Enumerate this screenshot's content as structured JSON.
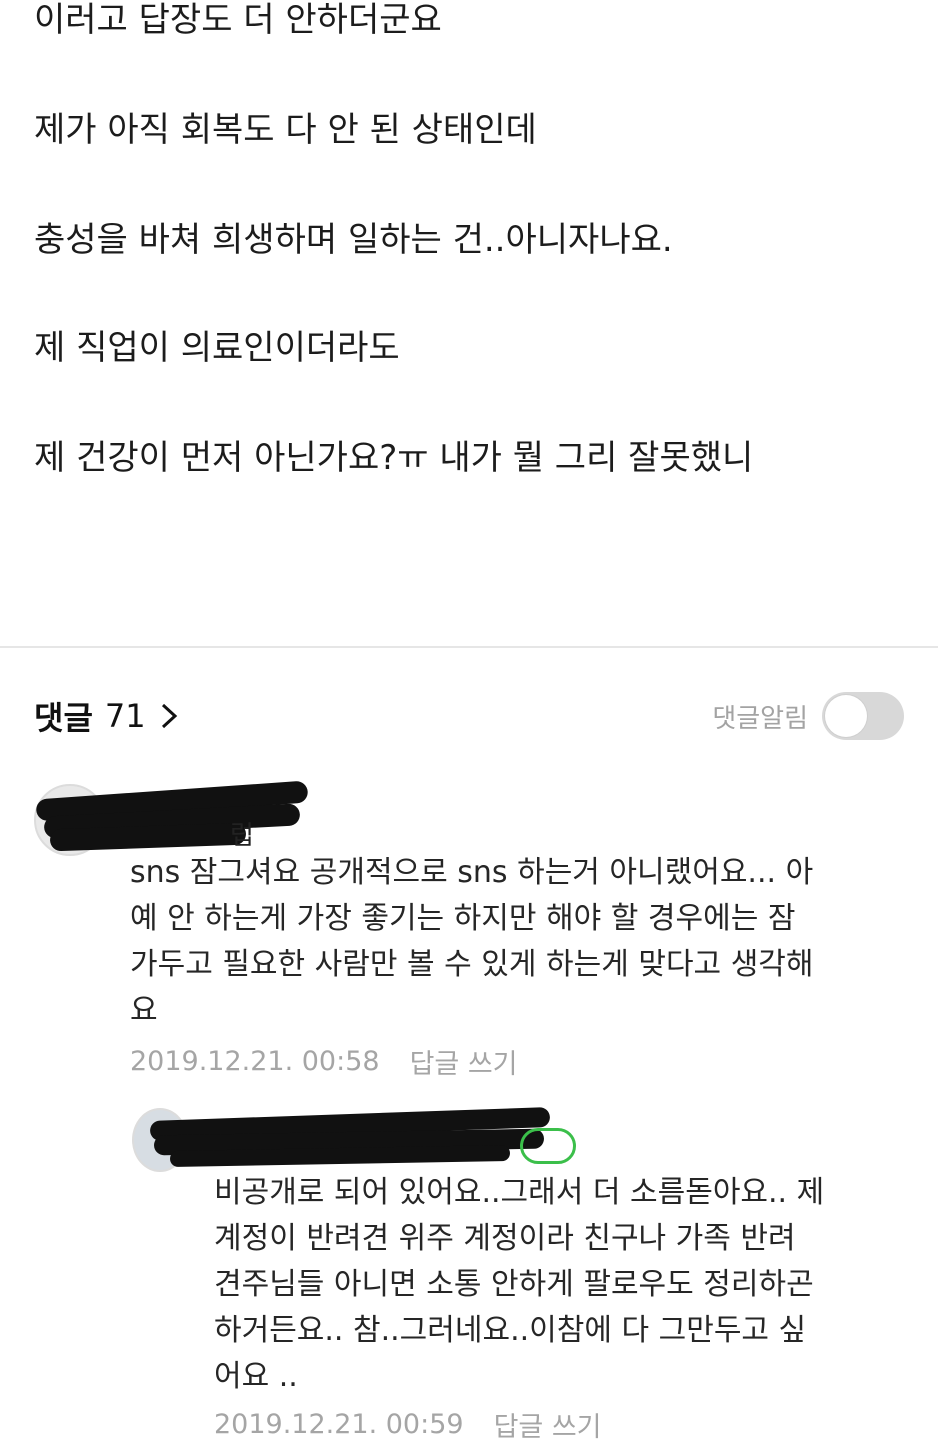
{
  "post": {
    "lines": [
      "이러고 답장도 더 안하더군요",
      "제가 아직 회복도 다 안 된 상태인데",
      "충성을 바쳐 희생하며 일하는 건..아니자나요.",
      "제 직업이 의료인이더라도",
      "제 건강이 먼저 아닌가요?ㅠ 내가 뭘 그리 잘못했니"
    ]
  },
  "comments_header": {
    "title": "댓글",
    "count": "71",
    "notify_label": "댓글알림",
    "notify_on": false
  },
  "comments": [
    {
      "nickname_visible_tail": "럽",
      "text_lines": [
        "sns 잠그셔요 공개적으로 sns 하는거 아니랬어요... 아",
        "예 안 하는게 가장 좋기는 하지만 해야 할 경우에는 잠",
        "가두고 필요한 사람만 볼 수 있게 하는게 맞다고 생각해",
        "요"
      ],
      "timestamp": "2019.12.21. 00:58",
      "reply_label": "답글 쓰기"
    },
    {
      "text_lines": [
        "비공개로 되어 있어요..그래서 더 소름돋아요.. 제",
        "계정이 반려견 위주 계정이라 친구나 가족 반려",
        "견주님들 아니면 소통 안하게 팔로우도 정리하곤",
        "하거든요.. 참..그러네요..이참에 다 그만두고 싶",
        "어요 .."
      ],
      "timestamp": "2019.12.21. 00:59",
      "reply_label": "답글 쓰기"
    }
  ],
  "colors": {
    "author_badge": "#3bbf4a",
    "muted_text": "#a5a5a5",
    "toggle_off": "#d8d8d8"
  }
}
